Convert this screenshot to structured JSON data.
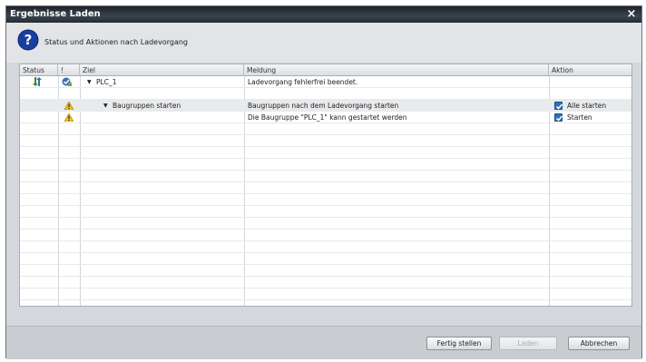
{
  "window": {
    "title": "Ergebnisse Laden",
    "close_label": "×"
  },
  "header": {
    "text": "Status und Aktionen nach Ladevorgang"
  },
  "columns": {
    "status": "Status",
    "excl": "!",
    "ziel": "Ziel",
    "meldung": "Meldung",
    "aktion": "Aktion"
  },
  "rows": [
    {
      "ziel": "PLC_1",
      "meldung": "Ladevorgang fehlerfrei beendet.",
      "aktion": ""
    },
    {
      "ziel": "Baugruppen starten",
      "meldung": "Baugruppen nach dem Ladevorgang starten",
      "aktion": "Alle starten"
    },
    {
      "ziel": "",
      "meldung": "Die Baugruppe \"PLC_1\" kann gestartet werden",
      "aktion": "Starten"
    }
  ],
  "buttons": {
    "finish": "Fertig stellen",
    "load": "Laden",
    "cancel": "Abbrechen"
  },
  "colors": {
    "titlebar": "#2a3139",
    "checkbox": "#2f6fb5",
    "warning": "#f2c21b"
  }
}
